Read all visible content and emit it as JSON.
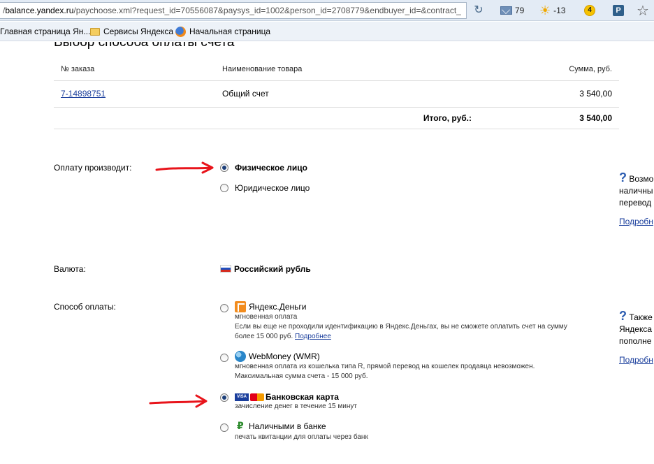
{
  "browser": {
    "url_host": "balance.yandex.ru",
    "url_prefix": "/",
    "url_path": "/paychoose.xml?request_id=70556087&paysys_id=1002&person_id=2708779&endbuyer_id=&contract_",
    "mail_count": "79",
    "weather": "-13",
    "badge": "4",
    "ext_p": "P"
  },
  "bookmarks": [
    {
      "label": "Главная страница Ян..."
    },
    {
      "label": "Сервисы Яндекса"
    },
    {
      "label": "Начальная страница"
    }
  ],
  "page": {
    "title": "Выбор способа оплаты счета",
    "table": {
      "headers": [
        "№ заказа",
        "Наименование товара",
        "Сумма, руб."
      ],
      "rows": [
        {
          "order": "7-14898751",
          "name": "Общий счет",
          "sum": "3 540,00"
        }
      ],
      "total_label": "Итого, руб.:",
      "total_value": "3 540,00"
    },
    "payer": {
      "label": "Оплату производит:",
      "options": [
        "Физическое лицо",
        "Юридическое лицо"
      ],
      "selected": 0
    },
    "currency": {
      "label": "Валюта:",
      "value": "Российский рубль"
    },
    "method": {
      "label": "Способ оплаты:",
      "options": [
        {
          "name": "Яндекс.Деньги",
          "sub": "мгновенная оплата",
          "desc1": "Если вы еще не проходили идентификацию в Яндекс.Деньгах, вы не сможете оплатить счет на сумму",
          "desc2": "более 15 000 руб.",
          "link": "Подробнее"
        },
        {
          "name": "WebMoney (WMR)",
          "sub": "мгновенная оплата из кошелька типа R, прямой перевод на кошелек продавца невозможен.",
          "desc1": "Максимальная сумма счета - 15 000 руб."
        },
        {
          "name": "Банковская карта",
          "sub": "зачисление денег в течение 15 минут"
        },
        {
          "name": "Наличными в банке",
          "sub": "печать квитанции для оплаты через банк"
        }
      ],
      "selected": 2
    },
    "side1": {
      "line1": "Возмо",
      "line2": "наличны",
      "line3": "перевод",
      "link": "Подробн"
    },
    "side2": {
      "line1": "Также",
      "line2": "Яндекса",
      "line3": "пополне",
      "link": "Подробн"
    }
  }
}
